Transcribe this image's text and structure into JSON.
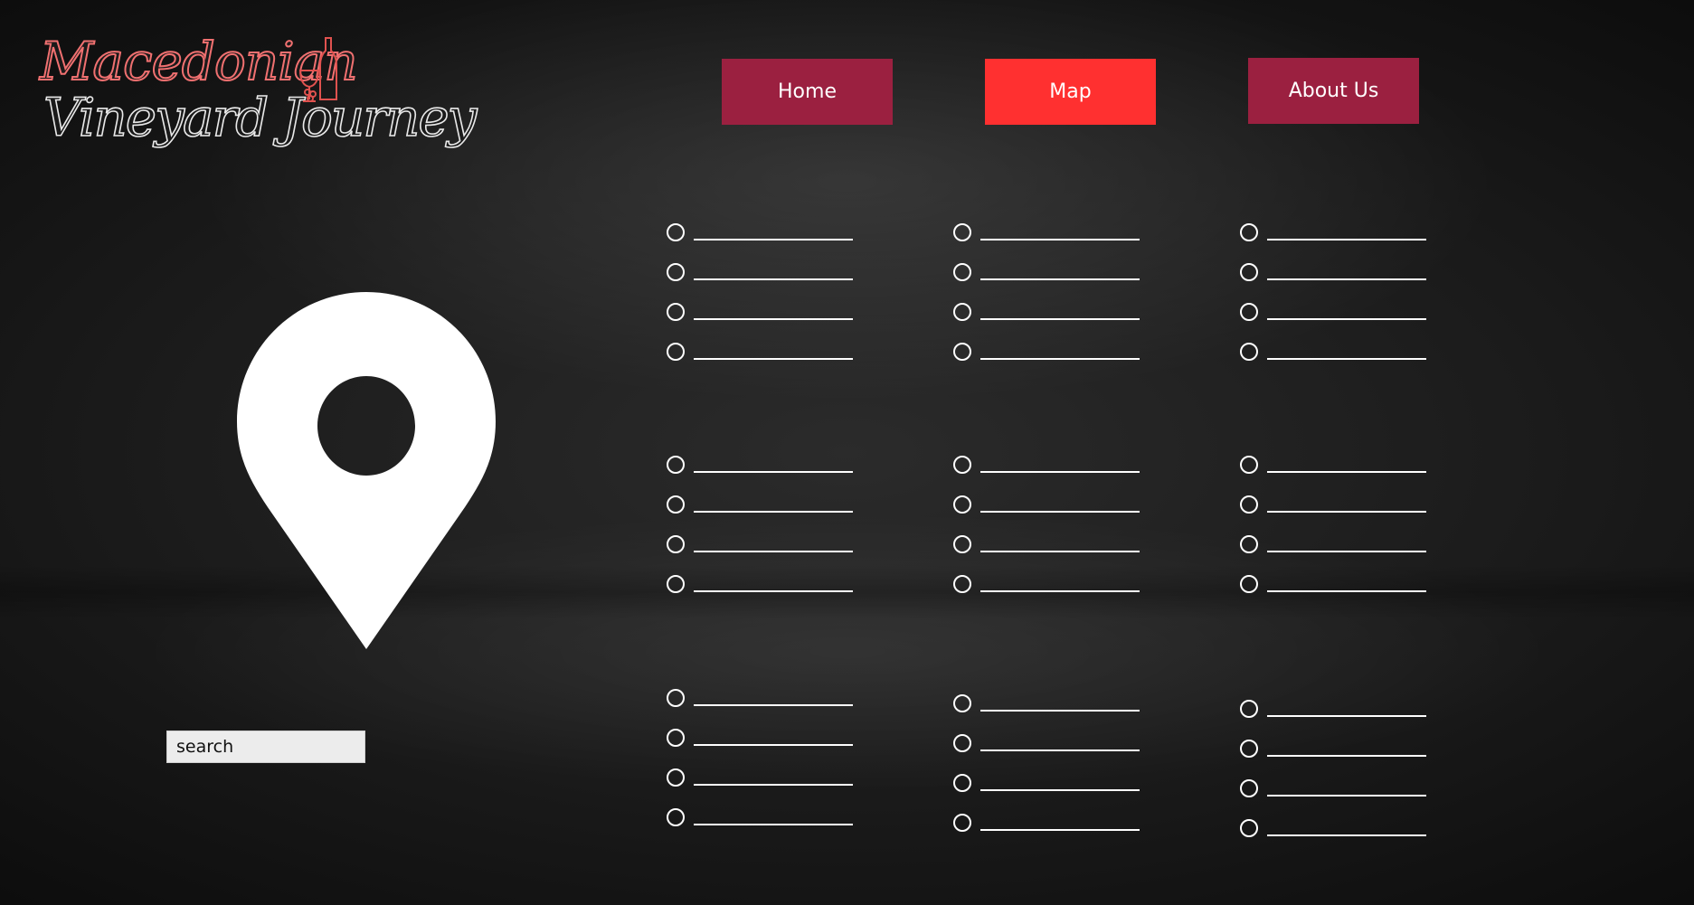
{
  "logo": {
    "line1": "Macedonian",
    "line2": "Vineyard Journey",
    "line1_color": "#f07070",
    "line2_color": "#e9e9e9",
    "icon": "wine-bottle-glass-icon"
  },
  "nav": {
    "home_label": "Home",
    "map_label": "Map",
    "about_label": "About Us",
    "active": "Map",
    "active_color": "#ff3030",
    "inactive_color": "#9b2040"
  },
  "map": {
    "pin_icon": "location-pin-icon",
    "pin_color": "#ffffff"
  },
  "search": {
    "placeholder": "search"
  },
  "option_groups": [
    {
      "column": 1,
      "row": 1,
      "count": 4
    },
    {
      "column": 2,
      "row": 1,
      "count": 4
    },
    {
      "column": 3,
      "row": 1,
      "count": 4
    },
    {
      "column": 1,
      "row": 2,
      "count": 4
    },
    {
      "column": 2,
      "row": 2,
      "count": 4
    },
    {
      "column": 3,
      "row": 2,
      "count": 4
    },
    {
      "column": 1,
      "row": 3,
      "count": 4
    },
    {
      "column": 2,
      "row": 3,
      "count": 4
    },
    {
      "column": 3,
      "row": 3,
      "count": 4
    }
  ]
}
